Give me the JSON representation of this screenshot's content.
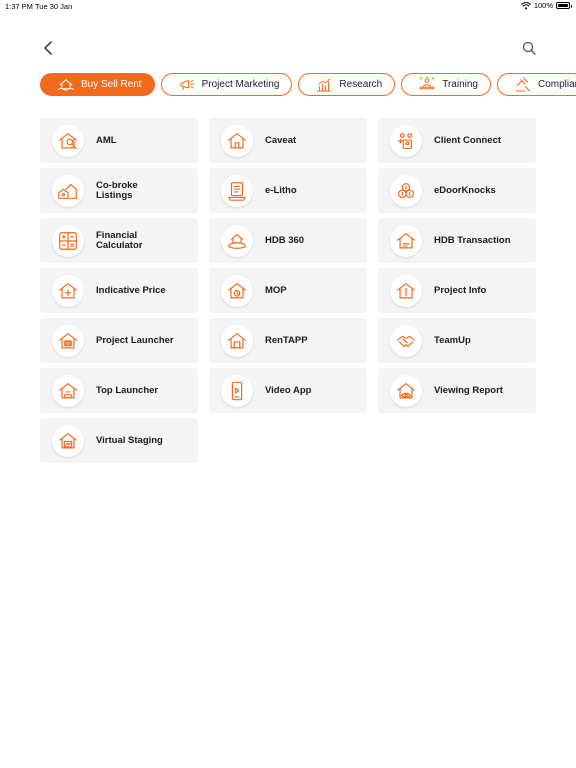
{
  "status": {
    "time": "1:37 PM",
    "date": "Tue 30 Jan",
    "battery": "100%"
  },
  "accent_color": "#f26a1b",
  "categories": [
    {
      "label": "Buy Sell Rent",
      "icon": "house-hands-icon",
      "active": true
    },
    {
      "label": "Project Marketing",
      "icon": "megaphone-icon",
      "active": false
    },
    {
      "label": "Research",
      "icon": "bar-chart-icon",
      "active": false
    },
    {
      "label": "Training",
      "icon": "presenter-icon",
      "active": false
    },
    {
      "label": "Compliance",
      "icon": "gavel-icon",
      "active": false
    }
  ],
  "apps": [
    {
      "label": "AML",
      "icon": "magnifier-house-icon"
    },
    {
      "label": "Caveat",
      "icon": "house-icon"
    },
    {
      "label": "Client Connect",
      "icon": "people-network-icon"
    },
    {
      "label": "Co-broke Listings",
      "icon": "houses-icon"
    },
    {
      "label": "e-Litho",
      "icon": "document-stack-icon"
    },
    {
      "label": "eDoorKnocks",
      "icon": "coins-icon"
    },
    {
      "label": "Financial Calculator",
      "icon": "calculator-icon"
    },
    {
      "label": "HDB 360",
      "icon": "house-360-icon"
    },
    {
      "label": "HDB Transaction",
      "icon": "house-hdb-icon"
    },
    {
      "label": "Indicative Price",
      "icon": "house-price-icon"
    },
    {
      "label": "MOP",
      "icon": "house-clock-icon"
    },
    {
      "label": "Project Info",
      "icon": "house-info-icon"
    },
    {
      "label": "Project Launcher",
      "icon": "building-launch-icon"
    },
    {
      "label": "RenTAPP",
      "icon": "house-rent-icon"
    },
    {
      "label": "TeamUp",
      "icon": "handshake-icon"
    },
    {
      "label": "Top Launcher",
      "icon": "house-top-icon"
    },
    {
      "label": "Video App",
      "icon": "phone-video-icon"
    },
    {
      "label": "Viewing Report",
      "icon": "house-eye-icon"
    },
    {
      "label": "Virtual Staging",
      "icon": "house-staging-icon"
    }
  ]
}
